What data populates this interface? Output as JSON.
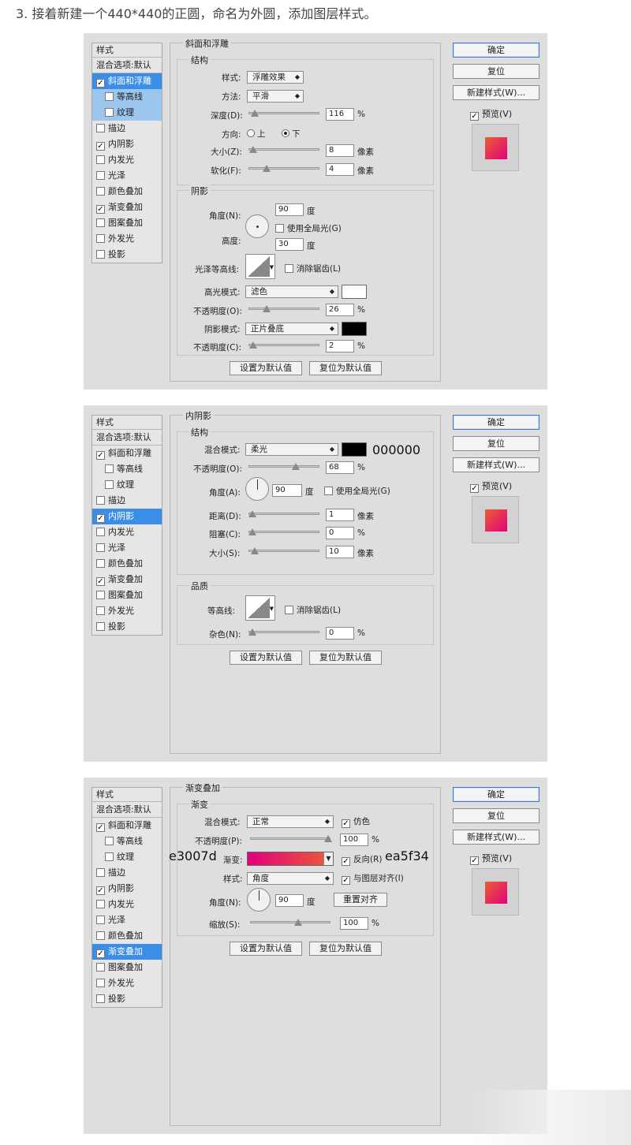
{
  "intro": "3. 接着新建一个440*440的正圆，命名为外圆，添加图层样式。",
  "common": {
    "styles_title": "样式",
    "blend_options": "混合选项:默认",
    "style_items": [
      "斜面和浮雕",
      "等高线",
      "纹理",
      "描边",
      "内阴影",
      "内发光",
      "光泽",
      "颜色叠加",
      "渐变叠加",
      "图案叠加",
      "外发光",
      "投影"
    ],
    "ok": "确定",
    "reset": "复位",
    "new_style": "新建样式(W)...",
    "preview": "预览(V)",
    "set_default": "设置为默认值",
    "reset_default": "复位为默认值",
    "check": "✓"
  },
  "panel1": {
    "title": "斜面和浮雕",
    "structure": "结构",
    "style_lbl": "样式:",
    "style_val": "浮雕效果",
    "technique_lbl": "方法:",
    "technique_val": "平滑",
    "depth_lbl": "深度(D):",
    "depth_val": "116",
    "pct": "%",
    "direction_lbl": "方向:",
    "up": "上",
    "down": "下",
    "size_lbl": "大小(Z):",
    "size_val": "8",
    "px": "像素",
    "soften_lbl": "软化(F):",
    "soften_val": "4",
    "shading": "阴影",
    "angle_lbl": "角度(N):",
    "angle_val": "90",
    "deg": "度",
    "global_light": "使用全局光(G)",
    "altitude_lbl": "高度:",
    "altitude_val": "30",
    "gloss_lbl": "光泽等高线:",
    "antialias": "消除锯齿(L)",
    "hl_mode_lbl": "高光模式:",
    "hl_mode_val": "滤色",
    "opacity_lbl": "不透明度(O):",
    "hl_opacity_val": "26",
    "sh_mode_lbl": "阴影模式:",
    "sh_mode_val": "正片叠底",
    "opacity2_lbl": "不透明度(C):",
    "sh_opacity_val": "2",
    "hl_color": "#ffffff",
    "sh_color": "#000000"
  },
  "panel2": {
    "title": "内阴影",
    "structure": "结构",
    "blend_lbl": "混合模式:",
    "blend_val": "柔光",
    "color": "#000000",
    "color_annot": "000000",
    "opacity_lbl": "不透明度(O):",
    "opacity_val": "68",
    "pct": "%",
    "angle_lbl": "角度(A):",
    "angle_val": "90",
    "deg": "度",
    "global_light": "使用全局光(G)",
    "distance_lbl": "距离(D):",
    "distance_val": "1",
    "px": "像素",
    "choke_lbl": "阻塞(C):",
    "choke_val": "0",
    "size_lbl": "大小(S):",
    "size_val": "10",
    "quality": "品质",
    "contour_lbl": "等高线:",
    "antialias": "消除锯齿(L)",
    "noise_lbl": "杂色(N):",
    "noise_val": "0"
  },
  "panel3": {
    "title": "渐变叠加",
    "gradient_grp": "渐变",
    "blend_lbl": "混合模式:",
    "blend_val": "正常",
    "dither": "仿色",
    "opacity_lbl": "不透明度(P):",
    "opacity_val": "100",
    "pct": "%",
    "gradient_lbl": "渐变:",
    "reverse": "反向(R)",
    "color_left": "e3007d",
    "color_right": "ea5f34",
    "style_lbl": "样式:",
    "style_val": "角度",
    "align": "与图层对齐(I)",
    "angle_lbl": "角度(N):",
    "angle_val": "90",
    "deg": "度",
    "reset_align": "重置对齐",
    "scale_lbl": "缩放(S):",
    "scale_val": "100"
  }
}
